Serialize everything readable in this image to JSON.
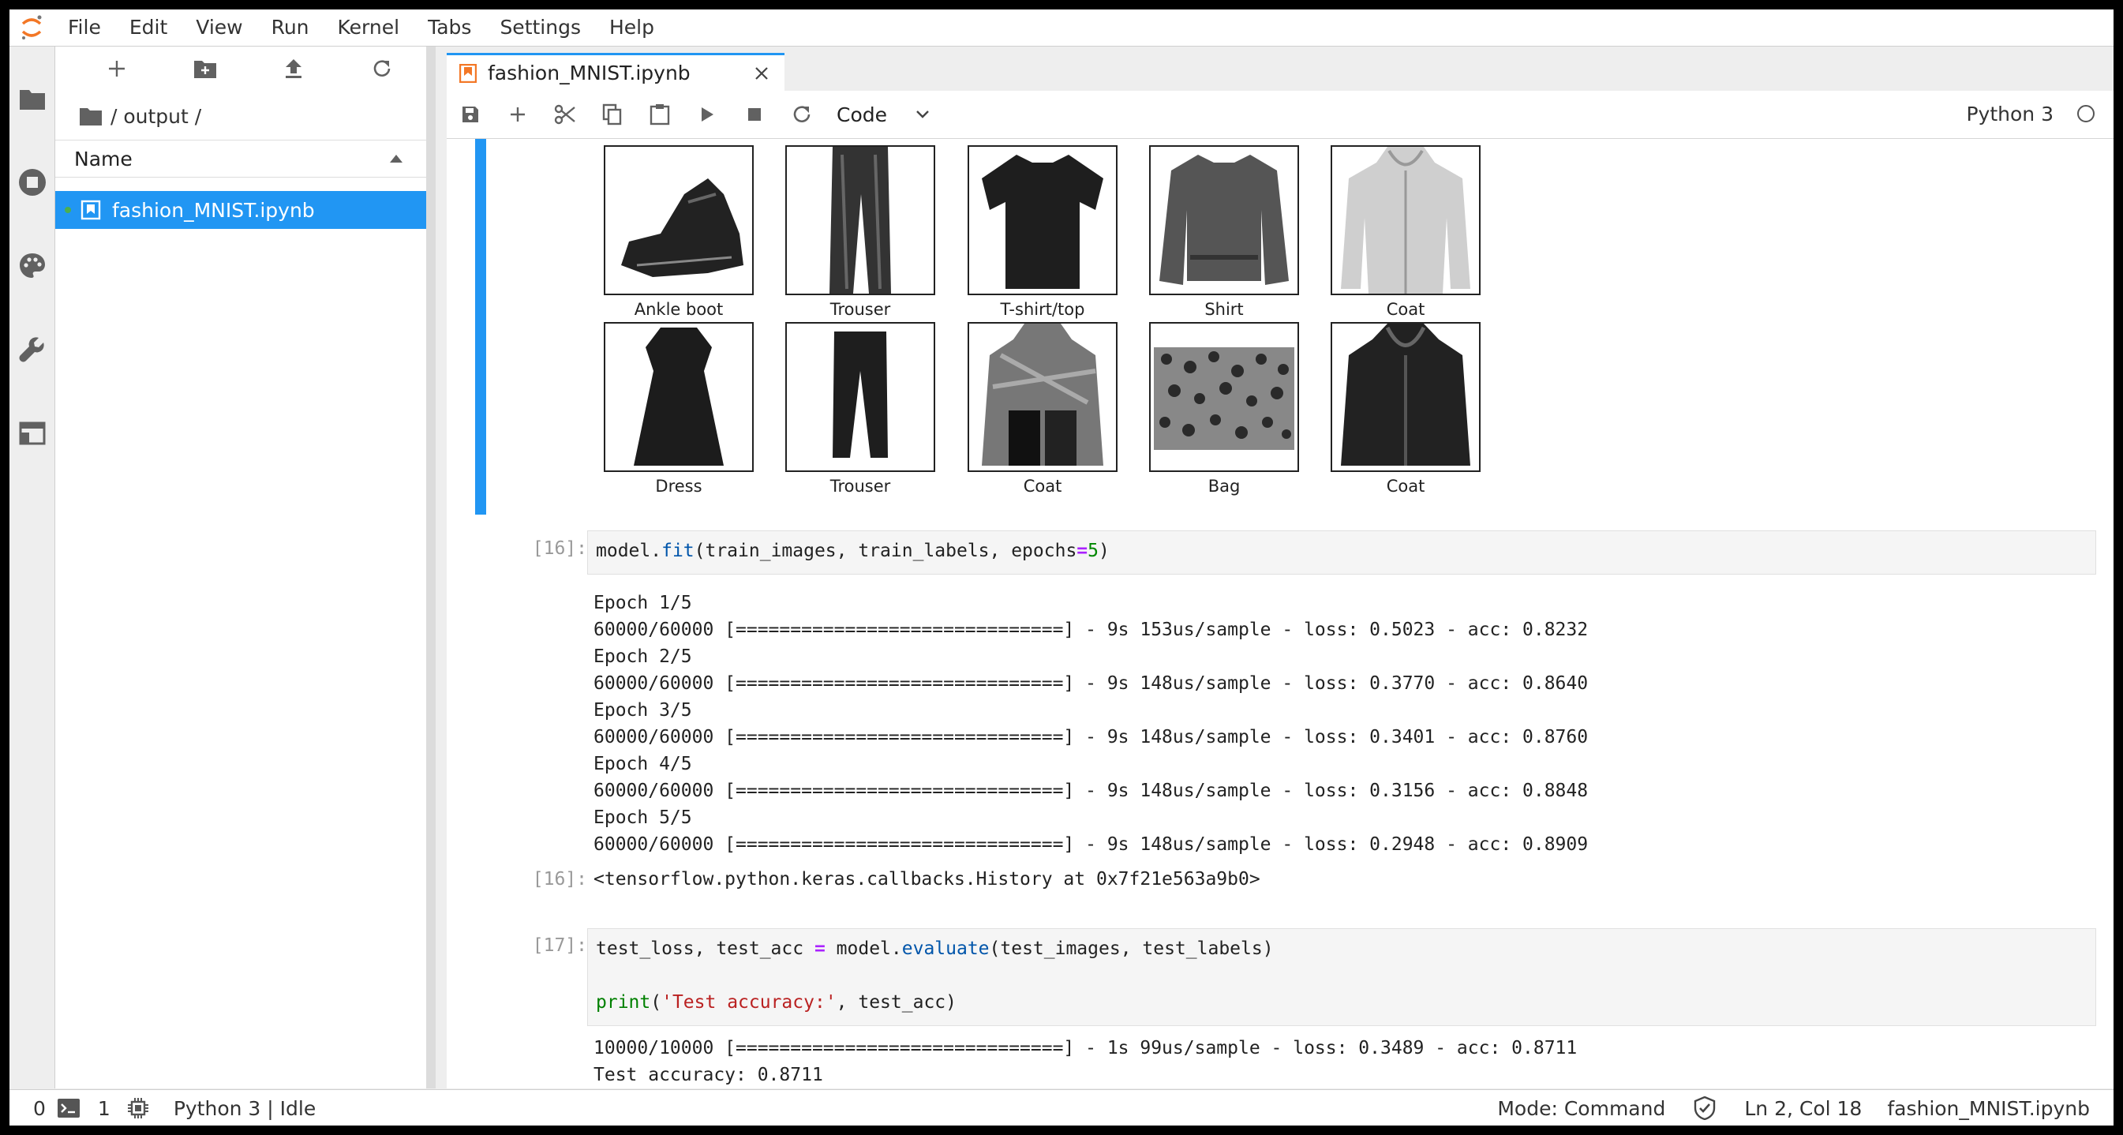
{
  "menubar": {
    "items": [
      "File",
      "Edit",
      "View",
      "Run",
      "Kernel",
      "Tabs",
      "Settings",
      "Help"
    ]
  },
  "rail": {
    "icons": [
      "folder-icon",
      "running-icon",
      "palette-icon",
      "wrench-icon",
      "tabs-icon"
    ]
  },
  "filebrowser": {
    "toolbar_icons": [
      "new-launcher-icon",
      "new-folder-icon",
      "upload-icon",
      "refresh-icon"
    ],
    "breadcrumb": "/ output /",
    "column_name": "Name",
    "files": [
      {
        "name": "fashion_MNIST.ipynb"
      }
    ]
  },
  "tab": {
    "title": "fashion_MNIST.ipynb"
  },
  "toolbar": {
    "cell_type": "Code",
    "kernel": "Python 3"
  },
  "figure": {
    "labels_row1": [
      "Ankle boot",
      "Trouser",
      "T-shirt/top",
      "Shirt",
      "Coat"
    ],
    "labels_row2": [
      "Dress",
      "Trouser",
      "Coat",
      "Bag",
      "Coat"
    ]
  },
  "cell16": {
    "prompt": "[16]:",
    "code": {
      "a": "model.",
      "fn": "fit",
      "b": "(train_images, train_labels, epochs",
      "op": "=",
      "num": "5",
      "c": ")"
    },
    "stream": [
      "Epoch 1/5",
      "60000/60000 [==============================] - 9s 153us/sample - loss: 0.5023 - acc: 0.8232",
      "Epoch 2/5",
      "60000/60000 [==============================] - 9s 148us/sample - loss: 0.3770 - acc: 0.8640",
      "Epoch 3/5",
      "60000/60000 [==============================] - 9s 148us/sample - loss: 0.3401 - acc: 0.8760",
      "Epoch 4/5",
      "60000/60000 [==============================] - 9s 148us/sample - loss: 0.3156 - acc: 0.8848",
      "Epoch 5/5",
      "60000/60000 [==============================] - 9s 148us/sample - loss: 0.2948 - acc: 0.8909"
    ],
    "result_prompt": "[16]:",
    "result": "<tensorflow.python.keras.callbacks.History at 0x7f21e563a9b0>"
  },
  "cell17": {
    "prompt": "[17]:",
    "line1": {
      "a": "test_loss, test_acc ",
      "op": "=",
      "b": " model.",
      "fn": "evaluate",
      "c": "(test_images, test_labels)"
    },
    "line3": {
      "fn": "print",
      "a": "(",
      "str": "'Test accuracy:'",
      "b": ", test_acc)"
    },
    "stream": [
      "10000/10000 [==============================] - 1s 99us/sample - loss: 0.3489 - acc: 0.8711",
      "Test accuracy: 0.8711"
    ]
  },
  "statusbar": {
    "zero": "0",
    "one": "1",
    "kernel_status": "Python 3 | Idle",
    "mode": "Mode: Command",
    "cursor": "Ln 2, Col 18",
    "file": "fashion_MNIST.ipynb"
  }
}
